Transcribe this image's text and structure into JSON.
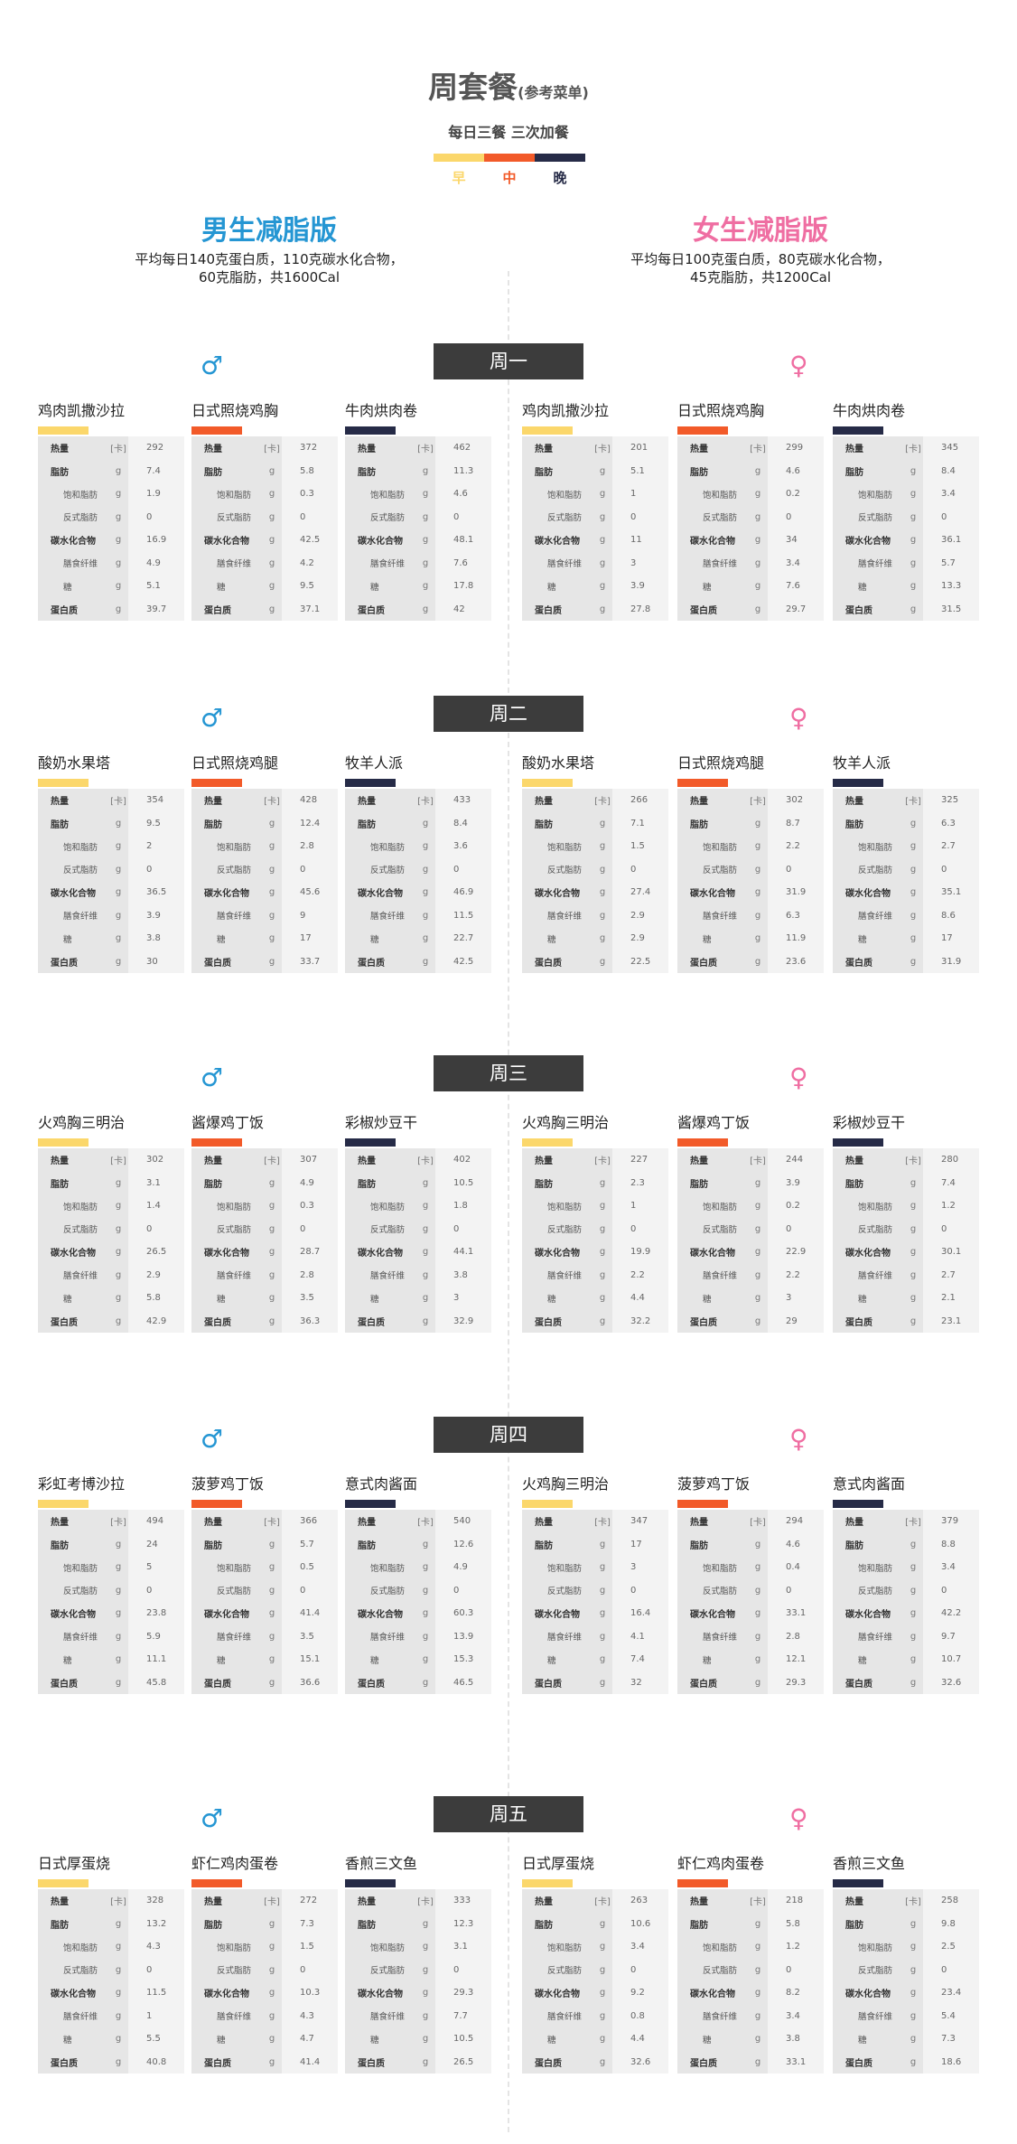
{
  "header": {
    "title": "周套餐",
    "title_note": "(参考菜单)",
    "subtitle": "每日三餐  三次加餐",
    "meal_labels": [
      "早",
      "中",
      "晚"
    ]
  },
  "colors": {
    "breakfast": "#fbd76b",
    "lunch": "#f25a29",
    "dinner": "#262b47",
    "male": "#2596d3",
    "female": "#ef6ea2"
  },
  "versions": {
    "male": {
      "title": "男生减脂版",
      "desc1": "平均每日140克蛋白质，110克碳水化合物，",
      "desc2": "60克脂肪，共1600Cal",
      "symbol": "♂"
    },
    "female": {
      "title": "女生减脂版",
      "desc1": "平均每日100克蛋白质，80克碳水化合物，",
      "desc2": "45克脂肪，共1200Cal",
      "symbol": "♀"
    }
  },
  "nutrients": [
    {
      "name": "热量",
      "unit": "[卡]",
      "style": "b"
    },
    {
      "name": "脂肪",
      "unit": "g",
      "style": "b"
    },
    {
      "name": "饱和脂肪",
      "unit": "g",
      "style": "sub"
    },
    {
      "name": "反式脂肪",
      "unit": "g",
      "style": "sub"
    },
    {
      "name": "碳水化合物",
      "unit": "g",
      "style": "b"
    },
    {
      "name": "膳食纤维",
      "unit": "g",
      "style": "sub"
    },
    {
      "name": "糖",
      "unit": "g",
      "style": "sub"
    },
    {
      "name": "蛋白质",
      "unit": "g",
      "style": "b"
    }
  ],
  "days": [
    {
      "label": "周一",
      "male": [
        {
          "name": "鸡肉凯撒沙拉",
          "values": [
            "292",
            "7.4",
            "1.9",
            "0",
            "16.9",
            "4.9",
            "5.1",
            "39.7"
          ]
        },
        {
          "name": "日式照烧鸡胸",
          "values": [
            "372",
            "5.8",
            "0.3",
            "0",
            "42.5",
            "4.2",
            "9.5",
            "37.1"
          ]
        },
        {
          "name": "牛肉烘肉卷",
          "values": [
            "462",
            "11.3",
            "4.6",
            "0",
            "48.1",
            "7.6",
            "17.8",
            "42"
          ]
        }
      ],
      "female": [
        {
          "name": "鸡肉凯撒沙拉",
          "values": [
            "201",
            "5.1",
            "1",
            "0",
            "11",
            "3",
            "3.9",
            "27.8"
          ]
        },
        {
          "name": "日式照烧鸡胸",
          "values": [
            "299",
            "4.6",
            "0.2",
            "0",
            "34",
            "3.4",
            "7.6",
            "29.7"
          ]
        },
        {
          "name": "牛肉烘肉卷",
          "values": [
            "345",
            "8.4",
            "3.4",
            "0",
            "36.1",
            "5.7",
            "13.3",
            "31.5"
          ]
        }
      ]
    },
    {
      "label": "周二",
      "male": [
        {
          "name": "酸奶水果塔",
          "values": [
            "354",
            "9.5",
            "2",
            "0",
            "36.5",
            "3.9",
            "3.8",
            "30"
          ]
        },
        {
          "name": "日式照烧鸡腿",
          "values": [
            "428",
            "12.4",
            "2.8",
            "0",
            "45.6",
            "9",
            "17",
            "33.7"
          ]
        },
        {
          "name": "牧羊人派",
          "values": [
            "433",
            "8.4",
            "3.6",
            "0",
            "46.9",
            "11.5",
            "22.7",
            "42.5"
          ]
        }
      ],
      "female": [
        {
          "name": "酸奶水果塔",
          "values": [
            "266",
            "7.1",
            "1.5",
            "0",
            "27.4",
            "2.9",
            "2.9",
            "22.5"
          ]
        },
        {
          "name": "日式照烧鸡腿",
          "values": [
            "302",
            "8.7",
            "2.2",
            "0",
            "31.9",
            "6.3",
            "11.9",
            "23.6"
          ]
        },
        {
          "name": "牧羊人派",
          "values": [
            "325",
            "6.3",
            "2.7",
            "0",
            "35.1",
            "8.6",
            "17",
            "31.9"
          ]
        }
      ]
    },
    {
      "label": "周三",
      "male": [
        {
          "name": "火鸡胸三明治",
          "values": [
            "302",
            "3.1",
            "1.4",
            "0",
            "26.5",
            "2.9",
            "5.8",
            "42.9"
          ]
        },
        {
          "name": "酱爆鸡丁饭",
          "values": [
            "307",
            "4.9",
            "0.3",
            "0",
            "28.7",
            "2.8",
            "3.5",
            "36.3"
          ]
        },
        {
          "name": "彩椒炒豆干",
          "values": [
            "402",
            "10.5",
            "1.8",
            "0",
            "44.1",
            "3.8",
            "3",
            "32.9"
          ]
        }
      ],
      "female": [
        {
          "name": "火鸡胸三明治",
          "values": [
            "227",
            "2.3",
            "1",
            "0",
            "19.9",
            "2.2",
            "4.4",
            "32.2"
          ]
        },
        {
          "name": "酱爆鸡丁饭",
          "values": [
            "244",
            "3.9",
            "0.2",
            "0",
            "22.9",
            "2.2",
            "3",
            "29"
          ]
        },
        {
          "name": "彩椒炒豆干",
          "values": [
            "280",
            "7.4",
            "1.2",
            "0",
            "30.1",
            "2.7",
            "2.1",
            "23.1"
          ]
        }
      ]
    },
    {
      "label": "周四",
      "male": [
        {
          "name": "彩虹考博沙拉",
          "values": [
            "494",
            "24",
            "5",
            "0",
            "23.8",
            "5.9",
            "11.1",
            "45.8"
          ]
        },
        {
          "name": "菠萝鸡丁饭",
          "values": [
            "366",
            "5.7",
            "0.5",
            "0",
            "41.4",
            "3.5",
            "15.1",
            "36.6"
          ]
        },
        {
          "name": "意式肉酱面",
          "values": [
            "540",
            "12.6",
            "4.9",
            "0",
            "60.3",
            "13.9",
            "15.3",
            "46.5"
          ]
        }
      ],
      "female": [
        {
          "name": "火鸡胸三明治",
          "values": [
            "347",
            "17",
            "3",
            "0",
            "16.4",
            "4.1",
            "7.4",
            "32"
          ]
        },
        {
          "name": "菠萝鸡丁饭",
          "values": [
            "294",
            "4.6",
            "0.4",
            "0",
            "33.1",
            "2.8",
            "12.1",
            "29.3"
          ]
        },
        {
          "name": "意式肉酱面",
          "values": [
            "379",
            "8.8",
            "3.4",
            "0",
            "42.2",
            "9.7",
            "10.7",
            "32.6"
          ]
        }
      ]
    },
    {
      "label": "周五",
      "male": [
        {
          "name": "日式厚蛋烧",
          "values": [
            "328",
            "13.2",
            "4.3",
            "0",
            "11.5",
            "1",
            "5.5",
            "40.8"
          ]
        },
        {
          "name": "虾仁鸡肉蛋卷",
          "values": [
            "272",
            "7.3",
            "1.5",
            "0",
            "10.3",
            "4.3",
            "4.7",
            "41.4"
          ]
        },
        {
          "name": "香煎三文鱼",
          "values": [
            "333",
            "12.3",
            "3.1",
            "0",
            "29.3",
            "7.7",
            "10.5",
            "26.5"
          ]
        }
      ],
      "female": [
        {
          "name": "日式厚蛋烧",
          "values": [
            "263",
            "10.6",
            "3.4",
            "0",
            "9.2",
            "0.8",
            "4.4",
            "32.6"
          ]
        },
        {
          "name": "虾仁鸡肉蛋卷",
          "values": [
            "218",
            "5.8",
            "1.2",
            "0",
            "8.2",
            "3.4",
            "3.8",
            "33.1"
          ]
        },
        {
          "name": "香煎三文鱼",
          "values": [
            "258",
            "9.8",
            "2.5",
            "0",
            "23.4",
            "5.4",
            "7.3",
            "18.6"
          ]
        }
      ]
    }
  ]
}
